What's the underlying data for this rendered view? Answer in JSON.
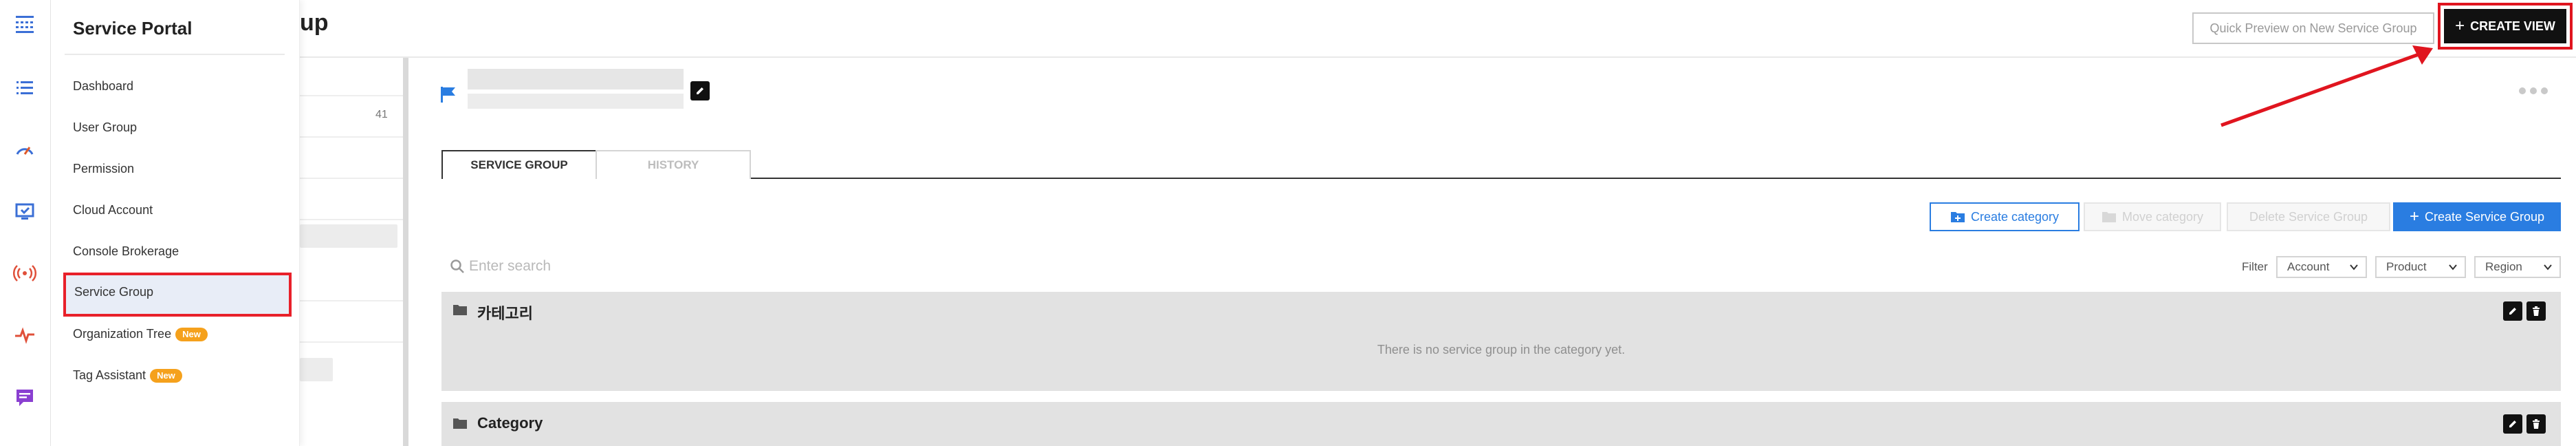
{
  "menu": {
    "title": "Service Portal",
    "items": [
      {
        "label": "Dashboard"
      },
      {
        "label": "User Group"
      },
      {
        "label": "Permission"
      },
      {
        "label": "Cloud Account"
      },
      {
        "label": "Console Brokerage"
      },
      {
        "label": "Service Group",
        "selected": true
      },
      {
        "label": "Organization Tree",
        "badge": "New"
      },
      {
        "label": "Tag Assistant",
        "badge": "New"
      }
    ]
  },
  "header": {
    "title_fragment": "up",
    "quick_preview_label": "Quick Preview on New Service Group",
    "create_view_label": "CREATE VIEW"
  },
  "list_panel": {
    "count": "41"
  },
  "tabs": [
    {
      "label": "SERVICE GROUP",
      "active": true
    },
    {
      "label": "HISTORY",
      "active": false
    }
  ],
  "actions": {
    "create_category": "Create category",
    "move_category": "Move category",
    "delete_service_group": "Delete Service Group",
    "create_service_group": "Create Service Group"
  },
  "search": {
    "placeholder": "Enter search"
  },
  "filters": {
    "label": "Filter",
    "selects": [
      {
        "label": "Account"
      },
      {
        "label": "Product"
      },
      {
        "label": "Region"
      }
    ]
  },
  "categories": [
    {
      "title": "카테고리",
      "empty_message": "There is no service group in the category yet."
    },
    {
      "title": "Category"
    }
  ],
  "colors": {
    "accent_blue": "#2a7de1",
    "highlight_red": "#e0151f",
    "badge_orange": "#f5a11c"
  }
}
